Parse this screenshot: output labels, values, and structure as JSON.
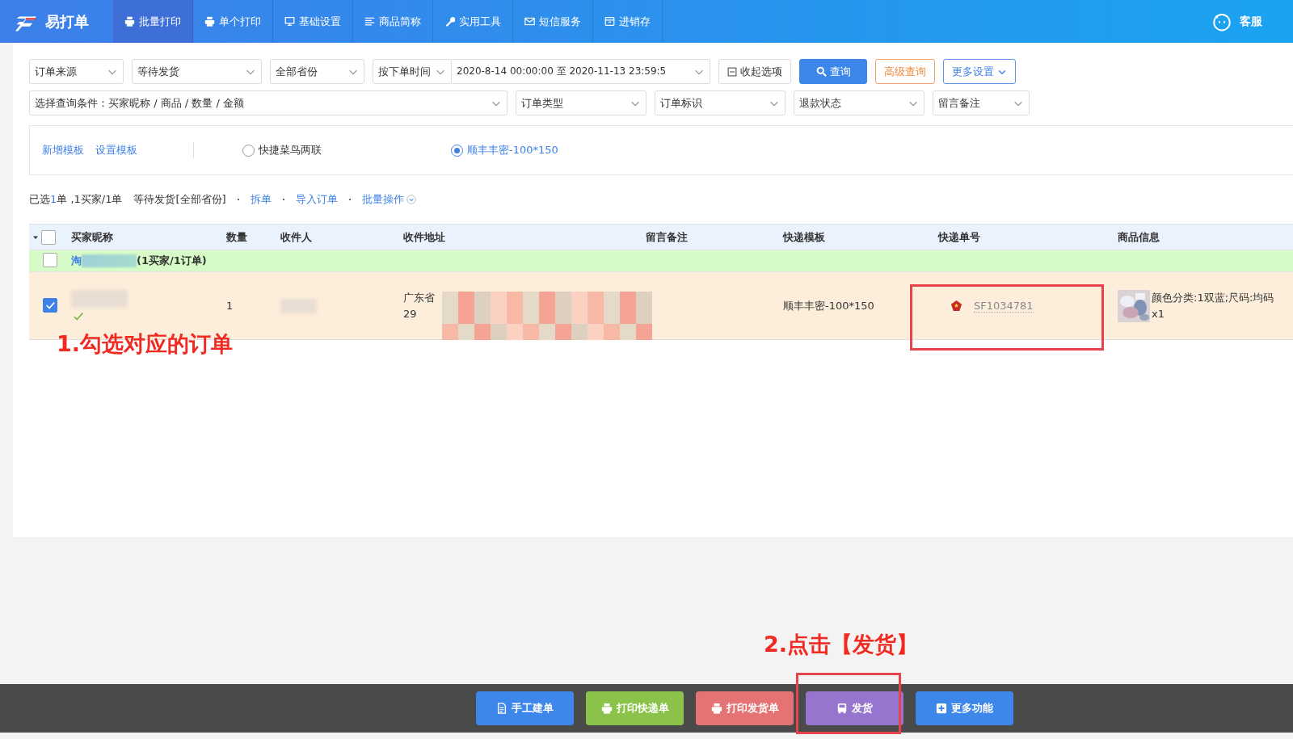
{
  "topbar": {
    "brand": "易打单",
    "nav": [
      {
        "label": "批量打印",
        "selected": true
      },
      {
        "label": "单个打印",
        "selected": false
      },
      {
        "label": "基础设置",
        "selected": false
      },
      {
        "label": "商品简称",
        "selected": false
      },
      {
        "label": "实用工具",
        "selected": false
      },
      {
        "label": "短信服务",
        "selected": false
      },
      {
        "label": "进销存",
        "selected": false
      }
    ],
    "support": "客服"
  },
  "filters": {
    "row1": [
      {
        "value": "订单来源"
      },
      {
        "value": "等待发货"
      },
      {
        "value": "全部省份"
      },
      {
        "value": "按下单时间"
      }
    ],
    "date_range": "2020-8-14 00:00:00 至 2020-11-13 23:59:5",
    "collapse_button": "收起选项",
    "search_button": "查询",
    "advanced_button": "高级查询",
    "more_settings_button": "更多设置",
    "condition": "选择查询条件：买家昵称 / 商品 / 数量 / 金额",
    "row2": [
      {
        "value": "订单类型"
      },
      {
        "value": "订单标识"
      },
      {
        "value": "退款状态"
      },
      {
        "value": "留言备注"
      }
    ]
  },
  "templates": {
    "links": [
      "新增模板",
      "设置模板"
    ],
    "options": [
      {
        "label": "快捷菜鸟两联",
        "selected": false
      },
      {
        "label": "顺丰丰密-100*150",
        "selected": true
      }
    ]
  },
  "summary": {
    "selected_prefix": "已选",
    "selected_count": "1",
    "selected_suffix": "单 ,1买家/1单",
    "status": "等待发货[全部省份]",
    "links": [
      "拆单",
      "导入订单",
      "批量操作"
    ]
  },
  "table": {
    "header_checked": false,
    "columns": [
      "买家昵称",
      "数量",
      "收件人",
      "收件地址",
      "留言备注",
      "快递模板",
      "快递单号",
      "商品信息"
    ],
    "group": {
      "checked": false,
      "shop": "淘",
      "count": "(1买家/1订单)"
    },
    "rows": [
      {
        "checked": true,
        "quantity": "1",
        "address_line_1": "广东省",
        "address_line_2": "29",
        "template": "顺丰丰密-100*150",
        "tracking": "SF1034781",
        "product": "颜色分类:1双蓝;尺码:均码",
        "product_qty": "x1"
      }
    ]
  },
  "annotations": [
    {
      "text": "1.勾选对应的订单"
    },
    {
      "text": "2.点击【发货】"
    }
  ],
  "actions": [
    {
      "label": "手工建单",
      "color": "#3d87ea"
    },
    {
      "label": "打印快递单",
      "color": "#8bc34a"
    },
    {
      "label": "打印发货单",
      "color": "#e57373"
    },
    {
      "label": "发货",
      "color": "#9575cd"
    },
    {
      "label": "更多功能",
      "color": "#3d87ea"
    }
  ]
}
